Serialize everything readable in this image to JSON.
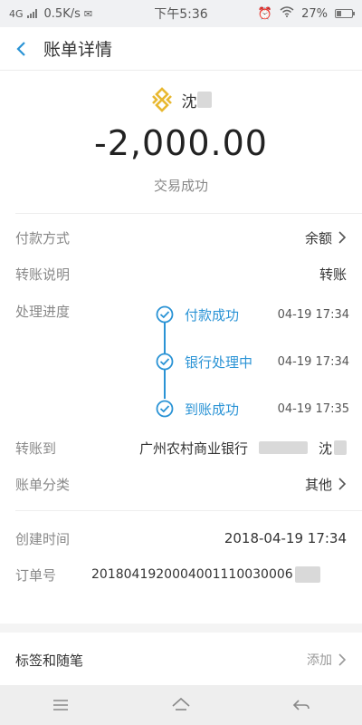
{
  "status_bar": {
    "network": "4G",
    "speed": "0.5K/s",
    "time": "下午5:36",
    "battery": "27%"
  },
  "header": {
    "title": "账单详情"
  },
  "summary": {
    "payee": "沈",
    "amount": "-2,000.00",
    "status": "交易成功"
  },
  "details": {
    "payment_method_label": "付款方式",
    "payment_method_value": "余额",
    "transfer_note_label": "转账说明",
    "transfer_note_value": "转账",
    "progress_label": "处理进度",
    "steps": [
      {
        "label": "付款成功",
        "time": "04-19 17:34"
      },
      {
        "label": "银行处理中",
        "time": "04-19 17:34"
      },
      {
        "label": "到账成功",
        "time": "04-19 17:35"
      }
    ],
    "transfer_to_label": "转账到",
    "transfer_to_bank": "广州农村商业银行",
    "transfer_to_name": "沈",
    "category_label": "账单分类",
    "category_value": "其他",
    "created_label": "创建时间",
    "created_value": "2018-04-19 17:34",
    "order_label": "订单号",
    "order_value": "2018041920004001110030006"
  },
  "tags": {
    "label": "标签和随笔",
    "action": "添加"
  },
  "colors": {
    "accent": "#2a93d5",
    "logo": "#e8b830"
  }
}
